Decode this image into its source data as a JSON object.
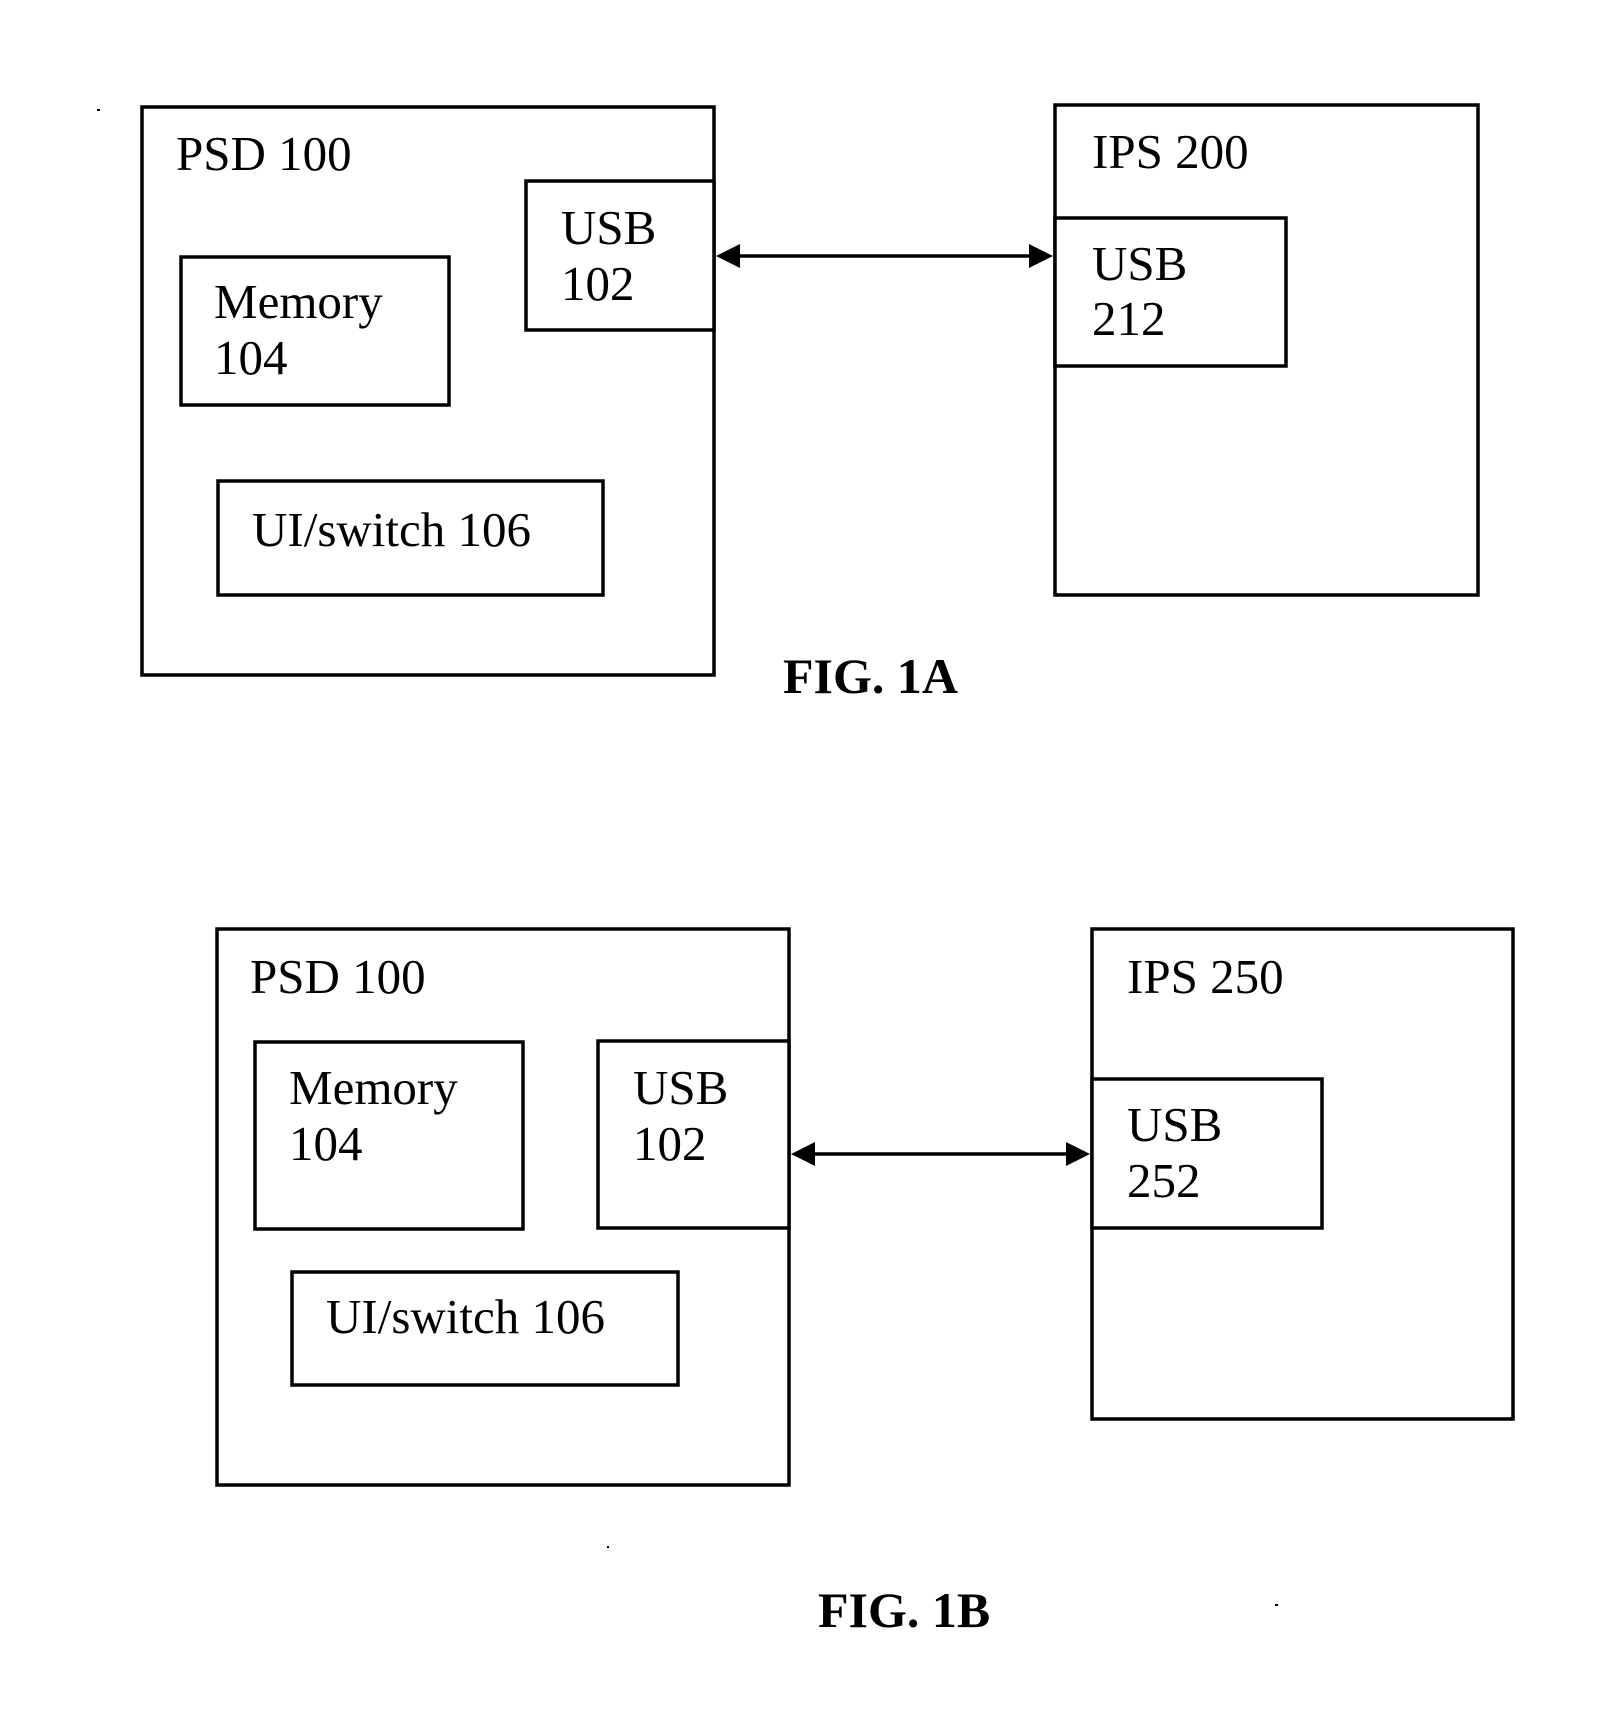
{
  "figures": [
    {
      "caption": "FIG. 1A",
      "psd": {
        "title": "PSD 100",
        "usb": {
          "line1": "USB",
          "line2": "102"
        },
        "memory": {
          "line1": "Memory",
          "line2": "104"
        },
        "ui_switch": "UI/switch 106"
      },
      "ips": {
        "title": "IPS 200",
        "usb": {
          "line1": "USB",
          "line2": "212"
        }
      },
      "connection": "bidirectional"
    },
    {
      "caption": "FIG. 1B",
      "psd": {
        "title": "PSD 100",
        "usb": {
          "line1": "USB",
          "line2": "102"
        },
        "memory": {
          "line1": "Memory",
          "line2": "104"
        },
        "ui_switch": "UI/switch 106"
      },
      "ips": {
        "title": "IPS 250",
        "usb": {
          "line1": "USB",
          "line2": "252"
        }
      },
      "connection": "bidirectional"
    }
  ]
}
